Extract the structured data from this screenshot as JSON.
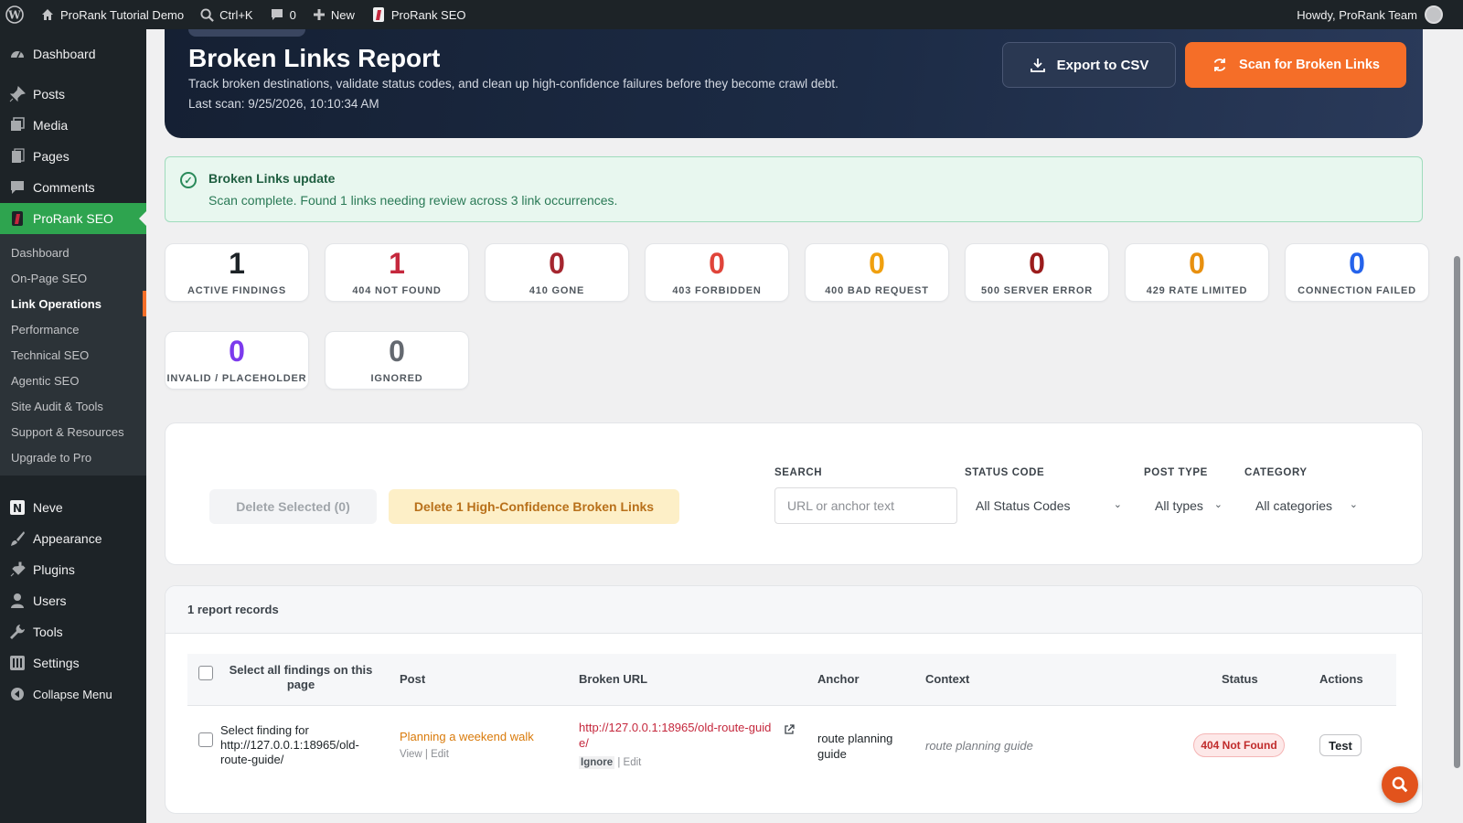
{
  "topbar": {
    "site_name": "ProRank Tutorial Demo",
    "search_shortcut": "Ctrl+K",
    "comments_count": "0",
    "new_label": "New",
    "plugin_label": "ProRank SEO",
    "howdy": "Howdy, ProRank Team"
  },
  "sidebar": {
    "items_top": [
      "Dashboard",
      "Posts",
      "Media",
      "Pages",
      "Comments"
    ],
    "active": "ProRank SEO",
    "submenu": [
      "Dashboard",
      "On-Page SEO",
      "Link Operations",
      "Performance",
      "Technical SEO",
      "Agentic SEO",
      "Site Audit & Tools",
      "Support & Resources",
      "Upgrade to Pro"
    ],
    "submenu_current": "Link Operations",
    "items_bottom": [
      "Neve",
      "Appearance",
      "Plugins",
      "Users",
      "Tools",
      "Settings",
      "Collapse Menu"
    ]
  },
  "hero": {
    "title": "Broken Links Report",
    "subtitle": "Track broken destinations, validate status codes, and clean up high-confidence failures before they become crawl debt.",
    "last_scan": "Last scan: 9/25/2026, 10:10:34 AM",
    "export_label": "Export to CSV",
    "scan_label": "Scan for Broken Links"
  },
  "notice": {
    "title": "Broken Links update",
    "body": "Scan complete. Found 1 links needing review across 3 link occurrences."
  },
  "stats": [
    {
      "value": "1",
      "label": "ACTIVE FINDINGS",
      "color": "#1d2327"
    },
    {
      "value": "1",
      "label": "404 NOT FOUND",
      "color": "#c5283d"
    },
    {
      "value": "0",
      "label": "410 GONE",
      "color": "#a5262f"
    },
    {
      "value": "0",
      "label": "403 FORBIDDEN",
      "color": "#e0443a"
    },
    {
      "value": "0",
      "label": "400 BAD REQUEST",
      "color": "#f0a00f"
    },
    {
      "value": "0",
      "label": "500 SERVER ERROR",
      "color": "#9b1c1c"
    },
    {
      "value": "0",
      "label": "429 RATE LIMITED",
      "color": "#e8900f"
    },
    {
      "value": "0",
      "label": "CONNECTION FAILED",
      "color": "#2563eb"
    },
    {
      "value": "0",
      "label": "INVALID / PLACEHOLDER",
      "color": "#7c3aed"
    },
    {
      "value": "0",
      "label": "IGNORED",
      "color": "#646970"
    }
  ],
  "filters": {
    "delete_selected": "Delete Selected (0)",
    "delete_confident": "Delete 1 High-Confidence Broken Links",
    "search_label": "SEARCH",
    "search_placeholder": "URL or anchor text",
    "status_label": "STATUS CODE",
    "status_value": "All Status Codes",
    "posttype_label": "POST TYPE",
    "posttype_value": "All types",
    "category_label": "CATEGORY",
    "category_value": "All categories"
  },
  "table": {
    "records": "1 report records",
    "select_all": "Select all findings on this page",
    "headers": {
      "post": "Post",
      "url": "Broken URL",
      "anchor": "Anchor",
      "context": "Context",
      "status": "Status",
      "actions": "Actions"
    },
    "row": {
      "select_label": "Select finding for http://127.0.0.1:18965/old-route-guide/",
      "post_title": "Planning a weekend walk",
      "view": "View",
      "edit": "Edit",
      "url": "http://127.0.0.1:18965/old-route-guide/",
      "ignore": "Ignore",
      "url_edit": "Edit",
      "anchor": "route planning guide",
      "context": "route planning guide",
      "status": "404 Not Found",
      "action": "Test"
    }
  }
}
